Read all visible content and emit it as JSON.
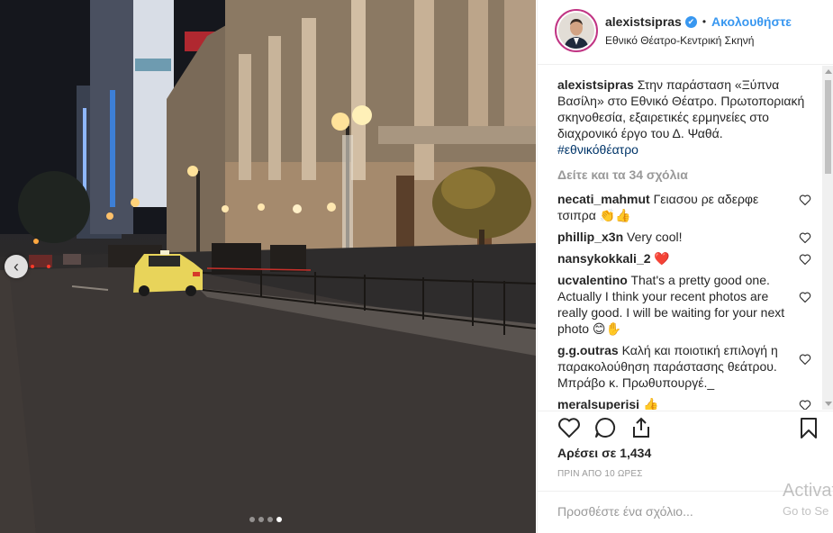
{
  "post": {
    "username": "alexistsipras",
    "verified_mark": "✔",
    "separator": "•",
    "follow_label": "Ακολουθήστε",
    "location": "Εθνικό Θέατρο-Κεντρική Σκηνή",
    "caption_user": "alexistsipras",
    "caption_text": "Στην παράσταση «Ξύπνα Βασίλη» στο Εθνικό Θέατρο. Πρωτοποριακή σκηνοθεσία, εξαιρετικές ερμηνείες στο διαχρονικό έργο του Δ. Ψαθά.",
    "caption_hashtag": "#εθνικόθέατρο",
    "view_all_comments": "Δείτε και τα 34 σχόλια",
    "likes": "Αρέσει σε 1,434",
    "timestamp": "ΠΡΙΝ ΑΠΟ 10 ΩΡΕΣ",
    "add_comment_placeholder": "Προσθέστε ένα σχόλιο..."
  },
  "comments": [
    {
      "user": "necati_mahmut",
      "text": "Γειασου ρε αδερφε τσιπρα 👏👍"
    },
    {
      "user": "phillip_x3n",
      "text": "Very cool!"
    },
    {
      "user": "nansykokkali_2",
      "text": "❤️"
    },
    {
      "user": "ucvalentino",
      "text": "That's a pretty good one. Actually I think your recent photos are really good. I will be waiting for your next photo 😊✋"
    },
    {
      "user": "g.g.outras",
      "text": "Καλή και ποιοτική επιλογή η παρακολούθηση παράστασης θεάτρου. Μπράβο κ. Πρωθυπουργέ._"
    },
    {
      "user": "meralsuperisi",
      "text": "👍"
    }
  ],
  "carousel": {
    "prev_glyph": "‹",
    "dots": 4,
    "active_dot": 3
  },
  "icons": {
    "like": "heart-icon",
    "comment": "comment-icon",
    "share": "share-icon",
    "save": "bookmark-icon",
    "comment_like": "heart-icon"
  },
  "watermark": {
    "line1": "Activate",
    "line2": "Go to Se"
  },
  "colors": {
    "link_blue": "#3897f0",
    "hashtag": "#003569",
    "muted": "#999999",
    "border": "#efefef"
  }
}
